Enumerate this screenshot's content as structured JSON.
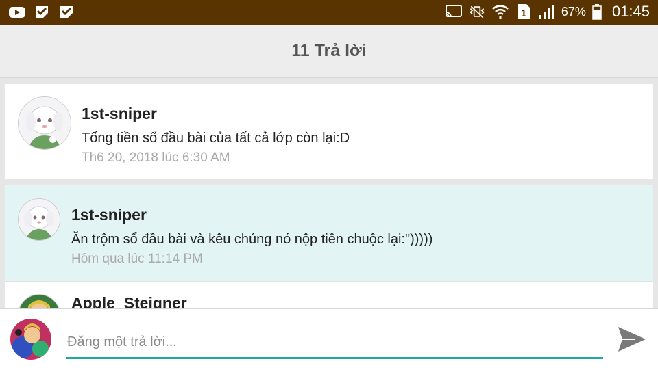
{
  "status_bar": {
    "left_icons": [
      "youtube-icon",
      "checklist-icon",
      "checklist-icon"
    ],
    "battery_percent": "67%",
    "time": "01:45",
    "sim_label": "1",
    "colors": {
      "background": "#5a3400"
    }
  },
  "header": {
    "title": "11 Trả lời"
  },
  "replies": [
    {
      "author": "1st-sniper",
      "text": "Tống tiền sổ đầu bài của tất cả lớp còn lại:D",
      "time": "Th6 20, 2018 lúc 6:30 AM"
    },
    {
      "author": "1st-sniper",
      "text": "Ăn trộm sổ đầu bài và kêu chúng nó nộp tiền chuộc lại:\")))))",
      "time": "Hôm qua lúc 11:14 PM"
    },
    {
      "author": "Apple_Steigner"
    }
  ],
  "composer": {
    "placeholder": "Đăng một trả lời...",
    "send_icon": "send-icon",
    "accent": "#1fa6a6"
  }
}
